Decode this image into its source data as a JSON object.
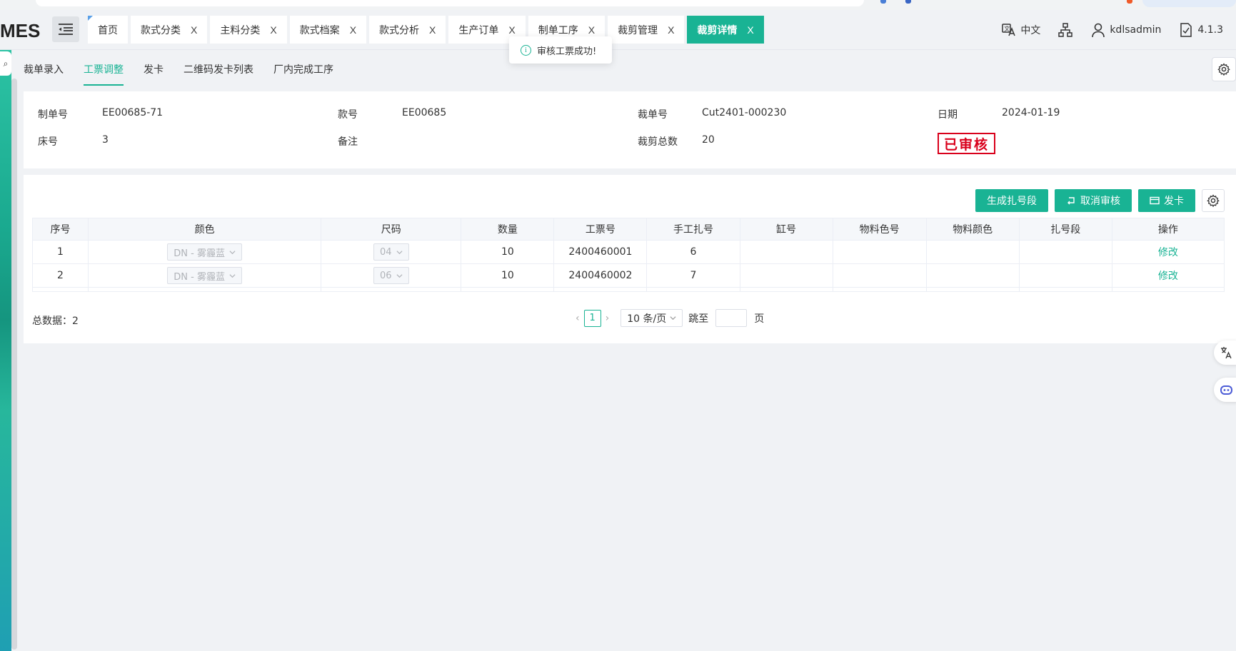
{
  "header": {
    "logo": "MES",
    "tabs": [
      {
        "label": "首页",
        "closable": false,
        "active": false
      },
      {
        "label": "款式分类",
        "closable": true,
        "active": false
      },
      {
        "label": "主料分类",
        "closable": true,
        "active": false
      },
      {
        "label": "款式档案",
        "closable": true,
        "active": false
      },
      {
        "label": "款式分析",
        "closable": true,
        "active": false
      },
      {
        "label": "生产订单",
        "closable": true,
        "active": false
      },
      {
        "label": "制单工序",
        "closable": true,
        "active": false
      },
      {
        "label": "裁剪管理",
        "closable": true,
        "active": false
      },
      {
        "label": "裁剪详情",
        "closable": true,
        "active": true
      }
    ],
    "close_glyph": "X",
    "language": "中文",
    "username": "kdlsadmin",
    "version": "4.1.3"
  },
  "subtabs": [
    {
      "label": "裁单录入",
      "active": false
    },
    {
      "label": "工票调整",
      "active": true
    },
    {
      "label": "发卡",
      "active": false
    },
    {
      "label": "二维码发卡列表",
      "active": false
    },
    {
      "label": "厂内完成工序",
      "active": false
    }
  ],
  "toast": {
    "message": "审核工票成功!"
  },
  "info": {
    "order_no_label": "制单号",
    "order_no": "EE00685-71",
    "style_no_label": "款号",
    "style_no": "EE00685",
    "cut_no_label": "裁单号",
    "cut_no": "Cut2401-000230",
    "date_label": "日期",
    "date": "2024-01-19",
    "bed_no_label": "床号",
    "bed_no": "3",
    "remark_label": "备注",
    "remark": "",
    "cut_total_label": "裁剪总数",
    "cut_total": "20",
    "stamp": "已审核"
  },
  "actions": {
    "generate": "生成扎号段",
    "cancel_review": "取消审核",
    "issue_card": "发卡"
  },
  "table": {
    "columns": [
      "序号",
      "颜色",
      "尺码",
      "数量",
      "工票号",
      "手工扎号",
      "缸号",
      "物料色号",
      "物料颜色",
      "扎号段",
      "操作"
    ],
    "rows": [
      {
        "seq": "1",
        "color": "DN - 雾霾蓝",
        "size": "04",
        "qty": "10",
        "ticket": "2400460001",
        "manual": "6",
        "vat": "",
        "mat_code": "",
        "mat_color": "",
        "bundle": "",
        "op": "修改"
      },
      {
        "seq": "2",
        "color": "DN - 雾霾蓝",
        "size": "06",
        "qty": "10",
        "ticket": "2400460002",
        "manual": "7",
        "vat": "",
        "mat_code": "",
        "mat_color": "",
        "bundle": "",
        "op": "修改"
      }
    ]
  },
  "pagination": {
    "total_label": "总数据：2",
    "current_page": "1",
    "page_size": "10 条/页",
    "jump_label": "跳至",
    "page_suffix": "页"
  },
  "colors": {
    "accent": "#19b394",
    "stamp": "#d9001b"
  }
}
